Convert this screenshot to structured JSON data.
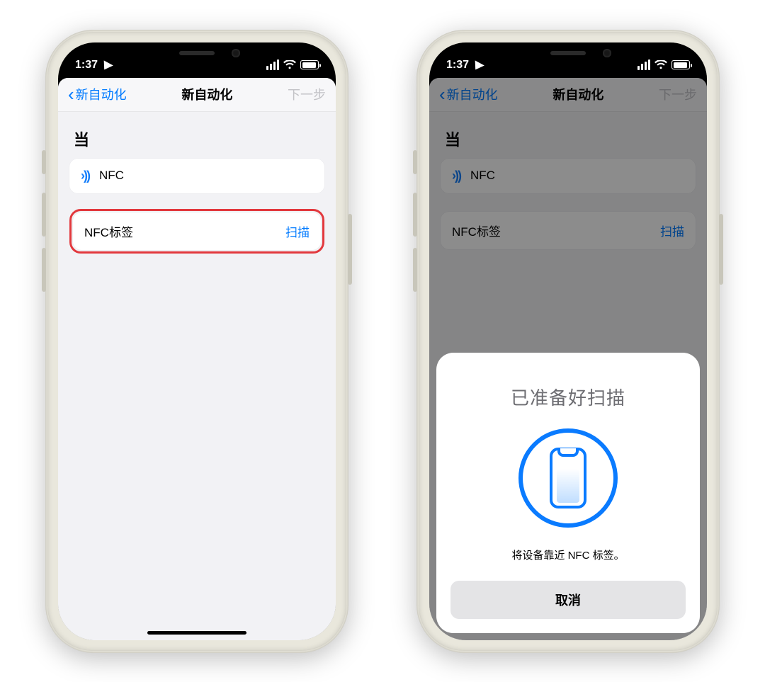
{
  "status": {
    "time": "1:37"
  },
  "nav": {
    "back": "新自动化",
    "title": "新自动化",
    "next": "下一步"
  },
  "section": {
    "when": "当"
  },
  "nfc_cell": {
    "label": "NFC"
  },
  "scan_cell": {
    "label": "NFC标签",
    "action": "扫描"
  },
  "sheet": {
    "title": "已准备好扫描",
    "message": "将设备靠近 NFC 标签。",
    "cancel": "取消"
  }
}
